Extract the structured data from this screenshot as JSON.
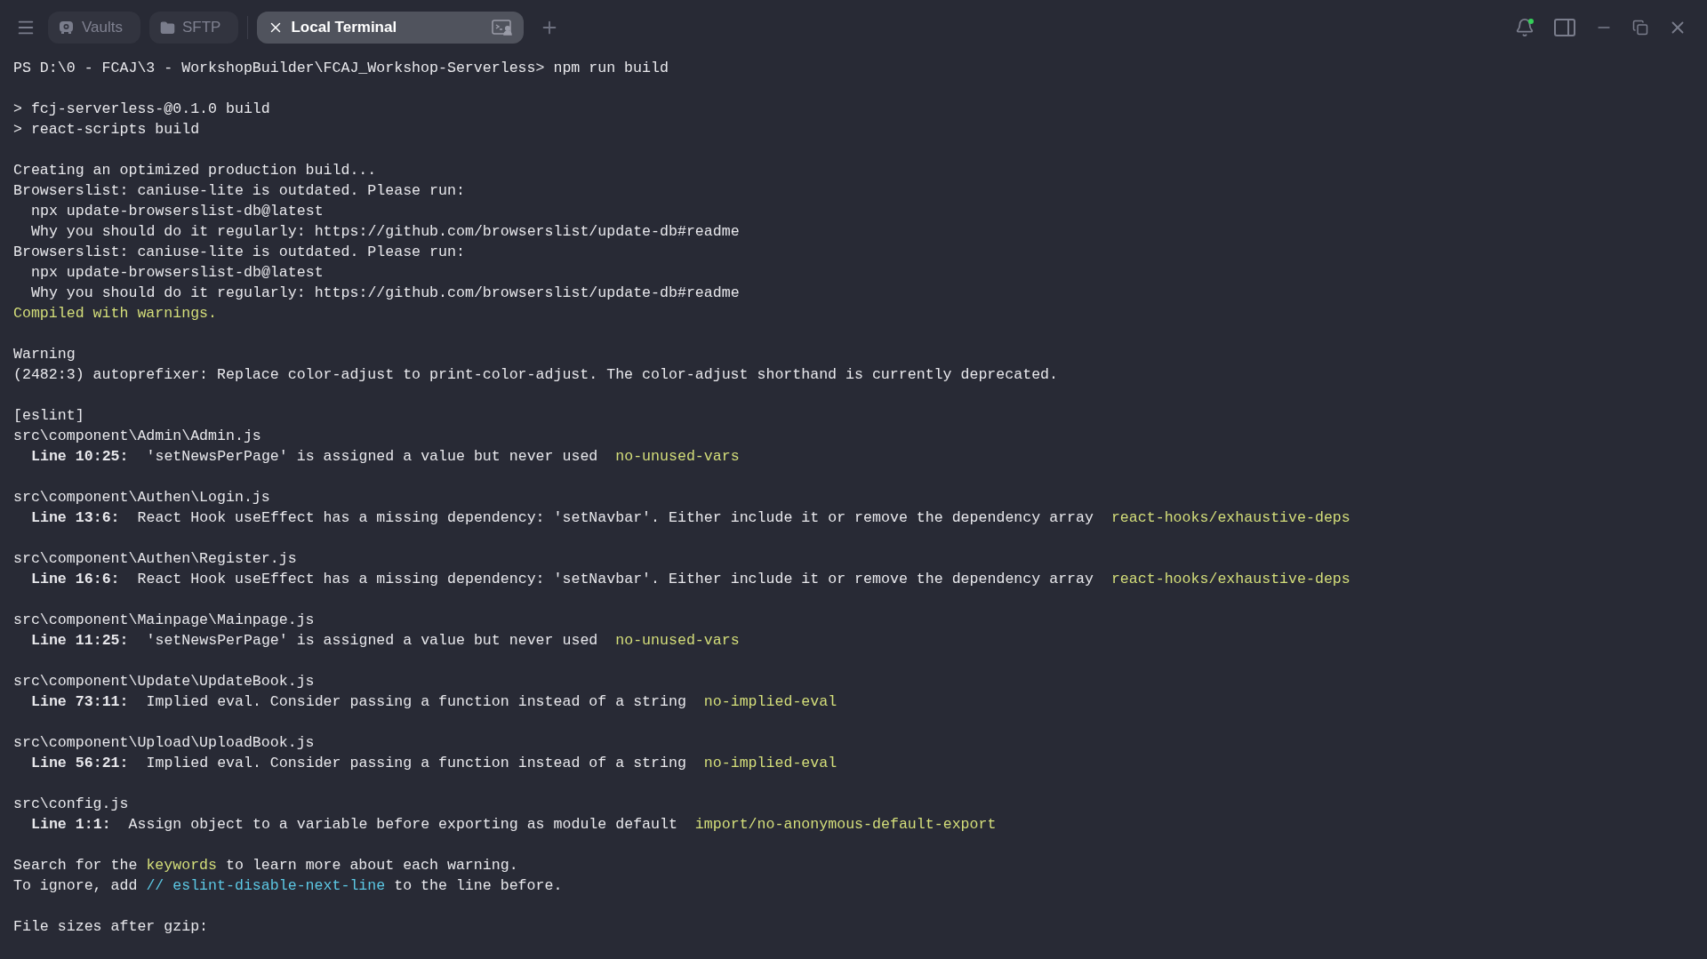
{
  "tabs": [
    {
      "kind": "vaults",
      "label": "Vaults",
      "selected": false
    },
    {
      "kind": "sftp",
      "label": "SFTP",
      "selected": false
    },
    {
      "kind": "terminal",
      "label": "Local Terminal",
      "selected": true
    }
  ],
  "notifications": {
    "unread": true
  },
  "terminal": {
    "lines": [
      {
        "kind": "text",
        "indented": false,
        "segments": [
          {
            "kind": "plain",
            "text": "PS D:\\0 - FCAJ\\3 - WorkshopBuilder\\FCAJ_Workshop-Serverless> npm run build"
          }
        ]
      },
      {
        "kind": "blank"
      },
      {
        "kind": "text",
        "indented": false,
        "segments": [
          {
            "kind": "plain",
            "text": "> fcj-serverless-@0.1.0 build"
          }
        ]
      },
      {
        "kind": "text",
        "indented": false,
        "segments": [
          {
            "kind": "plain",
            "text": "> react-scripts build"
          }
        ]
      },
      {
        "kind": "blank"
      },
      {
        "kind": "text",
        "indented": false,
        "segments": [
          {
            "kind": "plain",
            "text": "Creating an optimized production build..."
          }
        ]
      },
      {
        "kind": "text",
        "indented": false,
        "segments": [
          {
            "kind": "plain",
            "text": "Browserslist: caniuse-lite is outdated. Please run:"
          }
        ]
      },
      {
        "kind": "text",
        "indented": true,
        "segments": [
          {
            "kind": "plain",
            "text": "npx update-browserslist-db@latest"
          }
        ]
      },
      {
        "kind": "text",
        "indented": true,
        "segments": [
          {
            "kind": "plain",
            "text": "Why you should do it regularly: https://github.com/browserslist/update-db#readme"
          }
        ]
      },
      {
        "kind": "text",
        "indented": false,
        "segments": [
          {
            "kind": "plain",
            "text": "Browserslist: caniuse-lite is outdated. Please run:"
          }
        ]
      },
      {
        "kind": "text",
        "indented": true,
        "segments": [
          {
            "kind": "plain",
            "text": "npx update-browserslist-db@latest"
          }
        ]
      },
      {
        "kind": "text",
        "indented": true,
        "segments": [
          {
            "kind": "plain",
            "text": "Why you should do it regularly: https://github.com/browserslist/update-db#readme"
          }
        ]
      },
      {
        "kind": "text",
        "indented": false,
        "segments": [
          {
            "kind": "warn",
            "text": "Compiled with warnings."
          }
        ]
      },
      {
        "kind": "blank"
      },
      {
        "kind": "text",
        "indented": false,
        "segments": [
          {
            "kind": "plain",
            "text": "Warning"
          }
        ]
      },
      {
        "kind": "text",
        "indented": false,
        "segments": [
          {
            "kind": "plain",
            "text": "(2482:3) autoprefixer: Replace color-adjust to print-color-adjust. The color-adjust shorthand is currently deprecated."
          }
        ]
      },
      {
        "kind": "blank"
      },
      {
        "kind": "text",
        "indented": false,
        "segments": [
          {
            "kind": "plain",
            "text": "[eslint]"
          }
        ]
      },
      {
        "kind": "text",
        "indented": false,
        "segments": [
          {
            "kind": "plain",
            "text": "src\\component\\Admin\\Admin.js"
          }
        ]
      },
      {
        "kind": "text",
        "indented": true,
        "segments": [
          {
            "kind": "bold",
            "text": "Line 10:25:"
          },
          {
            "kind": "plain",
            "text": "  'setNewsPerPage' is assigned a value but never used  "
          },
          {
            "kind": "warn",
            "text": "no-unused-vars"
          }
        ]
      },
      {
        "kind": "blank"
      },
      {
        "kind": "text",
        "indented": false,
        "segments": [
          {
            "kind": "plain",
            "text": "src\\component\\Authen\\Login.js"
          }
        ]
      },
      {
        "kind": "text",
        "indented": true,
        "segments": [
          {
            "kind": "bold",
            "text": "Line 13:6:"
          },
          {
            "kind": "plain",
            "text": "  React Hook useEffect has a missing dependency: 'setNavbar'. Either include it or remove the dependency array  "
          },
          {
            "kind": "warn",
            "text": "react-hooks/exhaustive-deps"
          }
        ]
      },
      {
        "kind": "blank"
      },
      {
        "kind": "text",
        "indented": false,
        "segments": [
          {
            "kind": "plain",
            "text": "src\\component\\Authen\\Register.js"
          }
        ]
      },
      {
        "kind": "text",
        "indented": true,
        "segments": [
          {
            "kind": "bold",
            "text": "Line 16:6:"
          },
          {
            "kind": "plain",
            "text": "  React Hook useEffect has a missing dependency: 'setNavbar'. Either include it or remove the dependency array  "
          },
          {
            "kind": "warn",
            "text": "react-hooks/exhaustive-deps"
          }
        ]
      },
      {
        "kind": "blank"
      },
      {
        "kind": "text",
        "indented": false,
        "segments": [
          {
            "kind": "plain",
            "text": "src\\component\\Mainpage\\Mainpage.js"
          }
        ]
      },
      {
        "kind": "text",
        "indented": true,
        "segments": [
          {
            "kind": "bold",
            "text": "Line 11:25:"
          },
          {
            "kind": "plain",
            "text": "  'setNewsPerPage' is assigned a value but never used  "
          },
          {
            "kind": "warn",
            "text": "no-unused-vars"
          }
        ]
      },
      {
        "kind": "blank"
      },
      {
        "kind": "text",
        "indented": false,
        "segments": [
          {
            "kind": "plain",
            "text": "src\\component\\Update\\UpdateBook.js"
          }
        ]
      },
      {
        "kind": "text",
        "indented": true,
        "segments": [
          {
            "kind": "bold",
            "text": "Line 73:11:"
          },
          {
            "kind": "plain",
            "text": "  Implied eval. Consider passing a function instead of a string  "
          },
          {
            "kind": "warn",
            "text": "no-implied-eval"
          }
        ]
      },
      {
        "kind": "blank"
      },
      {
        "kind": "text",
        "indented": false,
        "segments": [
          {
            "kind": "plain",
            "text": "src\\component\\Upload\\UploadBook.js"
          }
        ]
      },
      {
        "kind": "text",
        "indented": true,
        "segments": [
          {
            "kind": "bold",
            "text": "Line 56:21:"
          },
          {
            "kind": "plain",
            "text": "  Implied eval. Consider passing a function instead of a string  "
          },
          {
            "kind": "warn",
            "text": "no-implied-eval"
          }
        ]
      },
      {
        "kind": "blank"
      },
      {
        "kind": "text",
        "indented": false,
        "segments": [
          {
            "kind": "plain",
            "text": "src\\config.js"
          }
        ]
      },
      {
        "kind": "text",
        "indented": true,
        "segments": [
          {
            "kind": "bold",
            "text": "Line 1:1:"
          },
          {
            "kind": "plain",
            "text": "  Assign object to a variable before exporting as module default  "
          },
          {
            "kind": "warn",
            "text": "import/no-anonymous-default-export"
          }
        ]
      },
      {
        "kind": "blank"
      },
      {
        "kind": "text",
        "indented": false,
        "segments": [
          {
            "kind": "plain",
            "text": "Search for the "
          },
          {
            "kind": "warn",
            "text": "keywords"
          },
          {
            "kind": "plain",
            "text": " to learn more about each warning."
          }
        ]
      },
      {
        "kind": "text",
        "indented": false,
        "segments": [
          {
            "kind": "plain",
            "text": "To ignore, add "
          },
          {
            "kind": "link",
            "text": "// eslint-disable-next-line"
          },
          {
            "kind": "plain",
            "text": " to the line before."
          }
        ]
      },
      {
        "kind": "blank"
      },
      {
        "kind": "text",
        "indented": false,
        "segments": [
          {
            "kind": "plain",
            "text": "File sizes after gzip:"
          }
        ]
      }
    ]
  }
}
